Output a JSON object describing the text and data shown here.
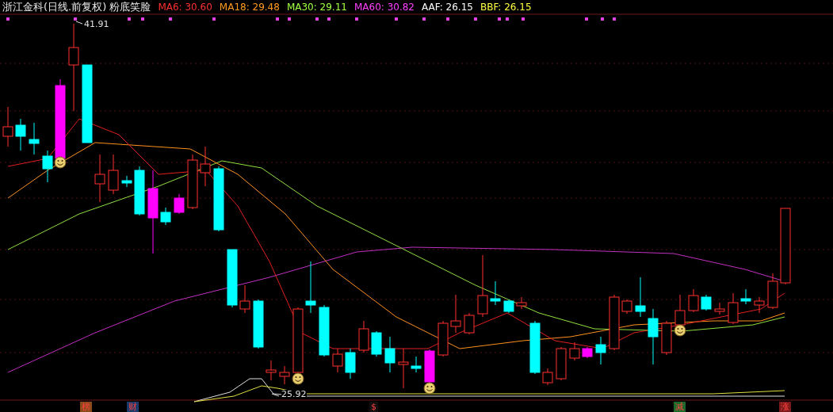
{
  "title": "浙江金科(日线.前复权) 粉底笑脸",
  "indicators": [
    {
      "label": "MA6: 30.60",
      "color": "#ff3030"
    },
    {
      "label": "MA18: 29.48",
      "color": "#ff9a20"
    },
    {
      "label": "MA30: 29.11",
      "color": "#a0ff40"
    },
    {
      "label": "MA60: 30.82",
      "color": "#ff40ff"
    },
    {
      "label": "AAF: 26.15",
      "color": "#ffffff"
    },
    {
      "label": "BBF: 26.15",
      "color": "#ffff40"
    }
  ],
  "high_label": "41.91",
  "low_label": "25.92",
  "markers": [
    {
      "label": "榜",
      "color": "#8a4a1a"
    },
    {
      "label": "财",
      "color": "#1a3a6a"
    },
    {
      "label": "$",
      "color": "#101010"
    },
    {
      "label": "减",
      "color": "#1a6a2a"
    },
    {
      "label": "涨",
      "color": "#7a1a1a"
    }
  ]
}
